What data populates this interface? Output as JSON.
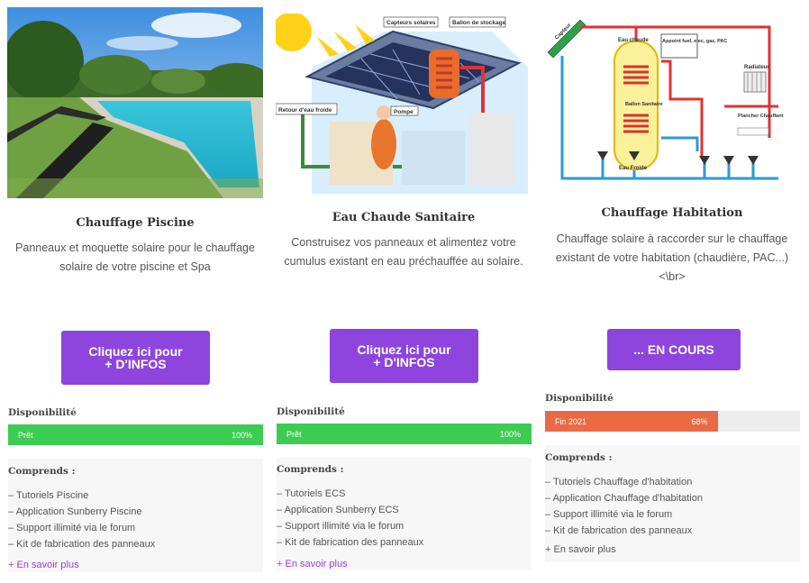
{
  "colors": {
    "accent": "#8d45dd",
    "ok": "#3ccc52",
    "progress": "#ea6a43",
    "track": "#ededed"
  },
  "cards": [
    {
      "title": "Chauffage Piscine",
      "description": "Panneaux et moquette solaire pour le chauffage solaire de votre piscine et Spa",
      "cta_line1": "Cliquez ici pour",
      "cta_line2": "+ D'INFOS",
      "availability_label": "Disponibilité",
      "progress": {
        "label": "Prêt",
        "percent_text": "100%",
        "value": 100,
        "color": "#3ccc52"
      },
      "includes_label": "Comprends :",
      "includes": [
        "– Tutoriels Piscine",
        "– Application Sunberry Piscine",
        "– Support illimité via le forum",
        "– Kit de fabrication des panneaux"
      ],
      "more_link": "+ En savoir plus"
    },
    {
      "title": "Eau Chaude Sanitaire",
      "description": "Construisez vos panneaux et alimentez votre cumulus existant en eau préchauffée au solaire.",
      "cta_line1": "Cliquez ici pour",
      "cta_line2": "+ D'INFOS",
      "availability_label": "Disponibilité",
      "progress": {
        "label": "Prêt",
        "percent_text": "100%",
        "value": 100,
        "color": "#3ccc52"
      },
      "includes_label": "Comprends :",
      "includes": [
        "– Tutoriels ECS",
        "– Application Sunberry ECS",
        "– Support illimité via le forum",
        "– Kit de fabrication des panneaux"
      ],
      "more_link": "+ En savoir plus",
      "diagram_labels": [
        "Capteurs solaires",
        "Ballon de stockage",
        "Retour d'eau froide",
        "Pompe"
      ]
    },
    {
      "title": "Chauffage Habitation",
      "description": "Chauffage solaire à raccorder sur le chauffage existant de votre habitation (chaudière, PAC...)<\\br>",
      "cta_line1": "... EN COURS",
      "availability_label": "Disponibilité",
      "progress": {
        "label": "Fin 2021",
        "percent_text": "68%",
        "value": 68,
        "color": "#ea6a43"
      },
      "includes_label": "Comprends :",
      "includes": [
        "– Tutoriels Chauffage d'habitation",
        "– Application Chauffage d'habitation",
        "– Support illimité via le forum",
        "– Kit de fabrication des panneaux"
      ],
      "more_link": "+ En savoir plus",
      "diagram_labels": [
        "Capteur",
        "Eau chaude",
        "Appoint fuel, elec, gaz, PAC",
        "Radiateur",
        "Ballon Sanitaire",
        "Plancher Chauffant",
        "Eau Froide"
      ]
    }
  ]
}
